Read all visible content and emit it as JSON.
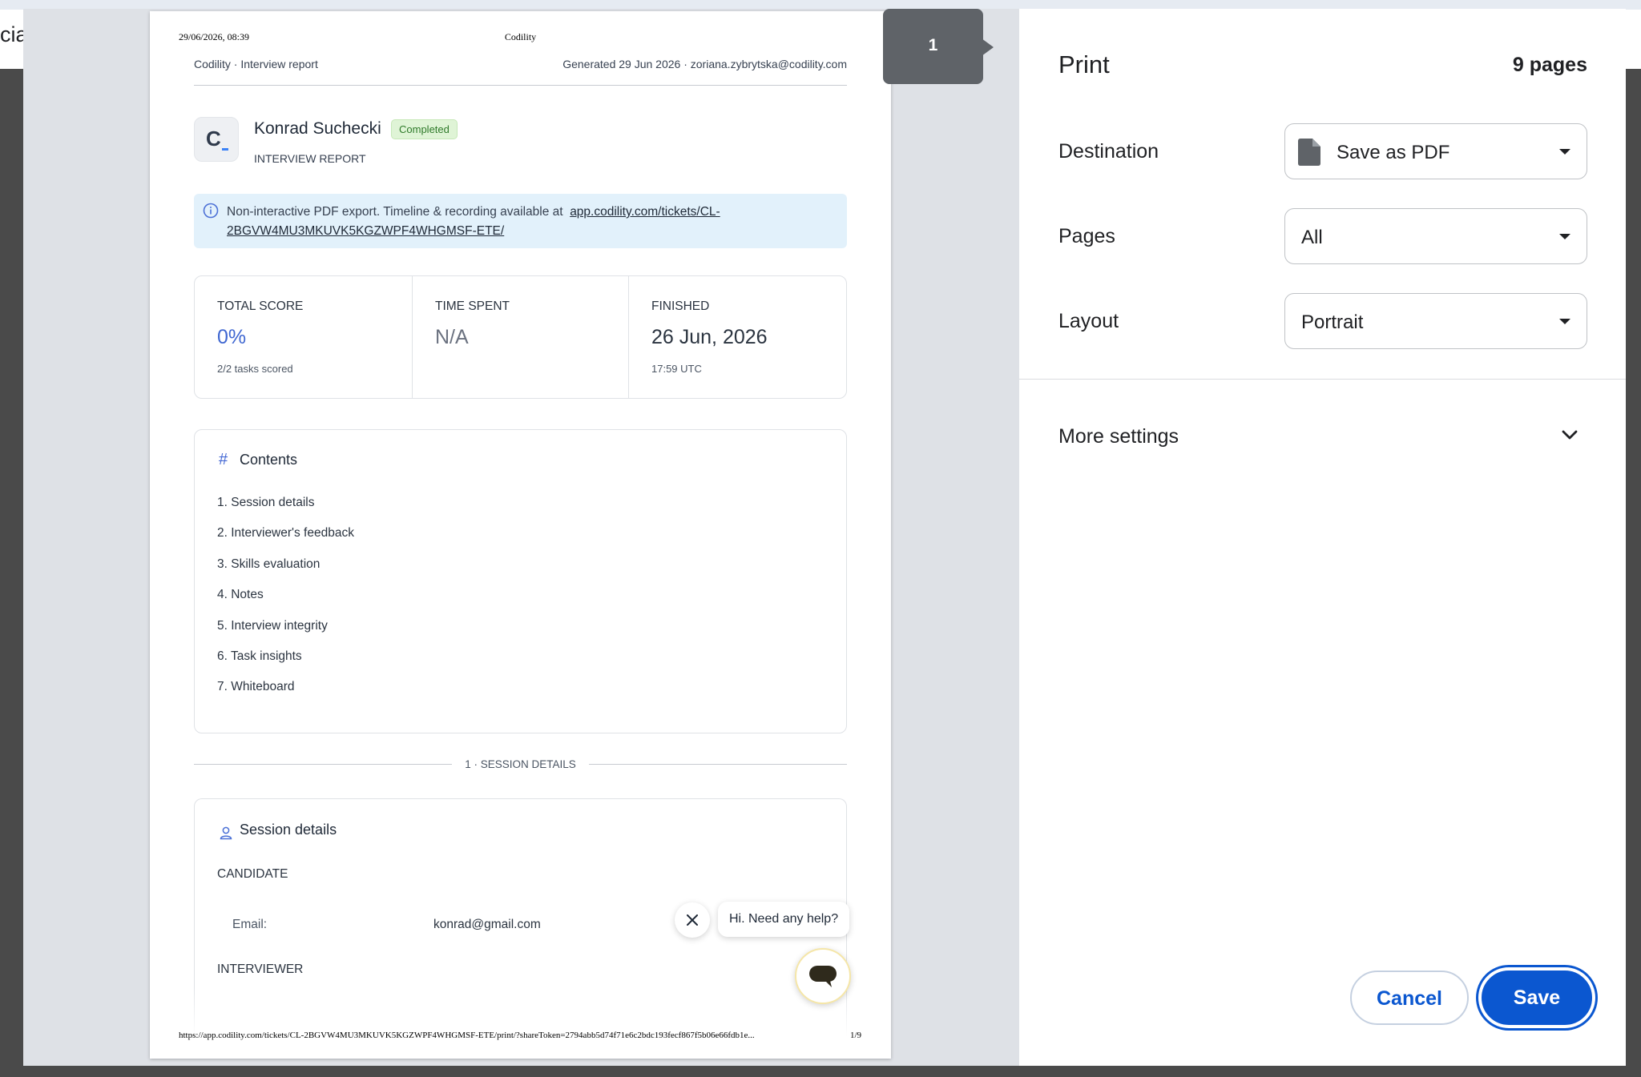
{
  "background_app": {
    "tab_text_fragment": "cial"
  },
  "preview": {
    "page_marker": "1",
    "print_header": {
      "date": "29/06/2026, 08:39",
      "title": "Codility"
    },
    "print_footer": {
      "url": "https://app.codility.com/tickets/CL-2BGVW4MU3MKUVK5KGZWPF4WHGMSF-ETE/print/?shareToken=2794abb5d74f71e6c2bdc193fecf867f5b06e66fdb1e...",
      "page": "1/9"
    },
    "report_header": {
      "left": "Codility · Interview report",
      "right": "Generated 29 Jun 2026 · zoriana.zybrytska@codility.com"
    },
    "candidate": {
      "logo_letter": "C",
      "name": "Konrad Suchecki",
      "status": "Completed",
      "subtitle": "INTERVIEW REPORT"
    },
    "notice": {
      "text": "Non-interactive PDF export. Timeline & recording available at",
      "link": "app.codility.com/tickets/CL-2BGVW4MU3MKUVK5KGZWPF4WHGMSF-ETE/"
    },
    "stats": [
      {
        "label": "TOTAL SCORE",
        "value": "0%",
        "sub": "2/2 tasks scored"
      },
      {
        "label": "TIME SPENT",
        "value": "N/A",
        "sub": ""
      },
      {
        "label": "FINISHED",
        "value": "26 Jun, 2026",
        "sub": "17:59 UTC"
      }
    ],
    "contents": {
      "hash": "#",
      "title": "Contents",
      "items": [
        "1. Session details",
        "2. Interviewer's feedback",
        "3. Skills evaluation",
        "4. Notes",
        "5. Interview integrity",
        "6. Task insights",
        "7. Whiteboard"
      ]
    },
    "section_label": "1 · SESSION DETAILS",
    "session": {
      "title": "Session details",
      "candidate_heading": "CANDIDATE",
      "email_label": "Email:",
      "email_value": "konrad@gmail.com",
      "interviewer_heading": "INTERVIEWER"
    },
    "chat": {
      "bubble": "Hi. Need any help?"
    }
  },
  "panel": {
    "title": "Print",
    "pages_count": "9 pages",
    "destination_label": "Destination",
    "destination_value": "Save as PDF",
    "pages_label": "Pages",
    "pages_value": "All",
    "layout_label": "Layout",
    "layout_value": "Portrait",
    "more_settings": "More settings",
    "cancel": "Cancel",
    "save": "Save"
  },
  "colors": {
    "accent": "#0b57d0",
    "score_blue": "#3f67d1",
    "badge_green": "#dff4d6",
    "notice_bg": "#e2f1fb"
  }
}
